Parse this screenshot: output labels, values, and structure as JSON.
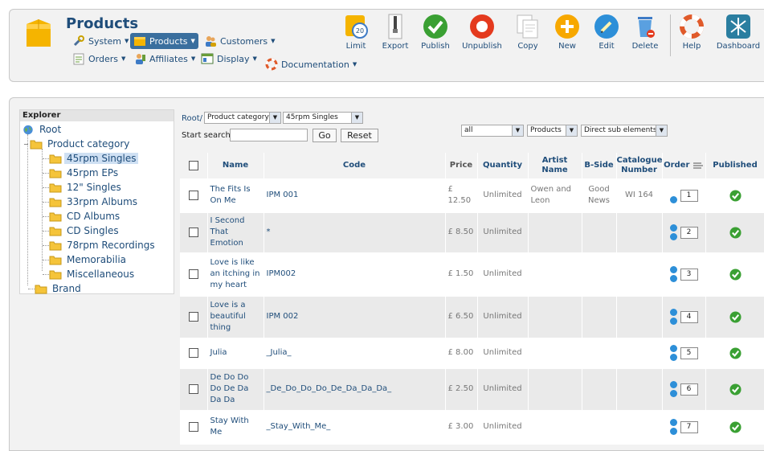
{
  "header": {
    "title": "Products",
    "menu": [
      {
        "label": "System",
        "icon": "wrench-icon"
      },
      {
        "label": "Products",
        "icon": "box-icon",
        "active": true
      },
      {
        "label": "Customers",
        "icon": "users-icon"
      },
      {
        "label": "Orders",
        "icon": "orders-icon"
      },
      {
        "label": "Affiliates",
        "icon": "affiliates-icon"
      },
      {
        "label": "Display",
        "icon": "display-icon"
      },
      {
        "label": "Documentation",
        "icon": "lifebuoy-icon"
      }
    ],
    "toolbar": [
      {
        "label": "Limit",
        "icon": "limit-icon"
      },
      {
        "label": "Export",
        "icon": "zipper-icon"
      },
      {
        "label": "Publish",
        "icon": "check-icon"
      },
      {
        "label": "Unpublish",
        "icon": "unpublish-icon"
      },
      {
        "label": "Copy",
        "icon": "copy-icon"
      },
      {
        "label": "New",
        "icon": "plus-icon"
      },
      {
        "label": "Edit",
        "icon": "pencil-icon"
      },
      {
        "label": "Delete",
        "icon": "trash-icon"
      },
      {
        "label": "Help",
        "icon": "help-icon"
      },
      {
        "label": "Dashboard",
        "icon": "dashboard-icon"
      }
    ]
  },
  "explorer": {
    "title": "Explorer",
    "root": "Root",
    "product_category": "Product category",
    "categories": [
      "45rpm Singles",
      "45rpm EPs",
      "12\" Singles",
      "33rpm Albums",
      "CD Albums",
      "CD Singles",
      "78rpm Recordings",
      "Memorabilia",
      "Miscellaneous"
    ],
    "selected": "45rpm Singles",
    "brand": "Brand"
  },
  "filters": {
    "breadcrumb_root": "Root/",
    "category_type": "Product category",
    "category_value": "45rpm Singles",
    "start_search_label": "Start search:",
    "search_value": "",
    "go_label": "Go",
    "reset_label": "Reset",
    "filter_all": "all",
    "filter_type": "Products",
    "filter_depth": "Direct sub elements"
  },
  "table": {
    "columns": [
      "Name",
      "Code",
      "Price",
      "Quantity",
      "Artist Name",
      "B-Side",
      "Catalogue Number",
      "Order",
      "Published"
    ],
    "rows": [
      {
        "name": "The Fits Is On Me",
        "code": "IPM 001",
        "price": "£ 12.50",
        "quantity": "Unlimited",
        "artist": "Owen and Leon",
        "bside": "Good News",
        "catalogue": "WI 164",
        "order": "1"
      },
      {
        "name": "I Second That Emotion",
        "code": "*",
        "price": "£ 8.50",
        "quantity": "Unlimited",
        "artist": "",
        "bside": "",
        "catalogue": "",
        "order": "2"
      },
      {
        "name": "Love is like an itching in my heart",
        "code": "IPM002",
        "price": "£ 1.50",
        "quantity": "Unlimited",
        "artist": "",
        "bside": "",
        "catalogue": "",
        "order": "3"
      },
      {
        "name": "Love is a beautiful thing",
        "code": "IPM 002",
        "price": "£ 6.50",
        "quantity": "Unlimited",
        "artist": "",
        "bside": "",
        "catalogue": "",
        "order": "4"
      },
      {
        "name": "Julia",
        "code": "_Julia_",
        "price": "£ 8.00",
        "quantity": "Unlimited",
        "artist": "",
        "bside": "",
        "catalogue": "",
        "order": "5"
      },
      {
        "name": "De Do Do Do De Da Da Da",
        "code": "_De_Do_Do_Do_De_Da_Da_Da_",
        "price": "£ 2.50",
        "quantity": "Unlimited",
        "artist": "",
        "bside": "",
        "catalogue": "",
        "order": "6"
      },
      {
        "name": "Stay With Me",
        "code": "_Stay_With_Me_",
        "price": "£ 3.00",
        "quantity": "Unlimited",
        "artist": "",
        "bside": "",
        "catalogue": "",
        "order": "7"
      }
    ]
  }
}
